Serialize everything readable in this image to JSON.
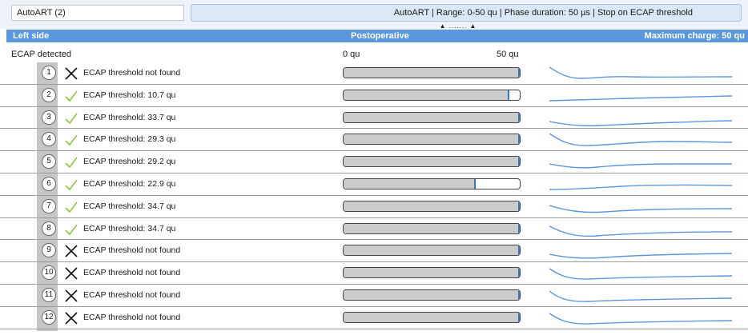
{
  "toolbar": {
    "tab_label": "AutoART (2)",
    "info": "AutoART | Range: 0-50 qu | Phase duration: 50 µs | Stop on ECAP threshold",
    "grip": "▲ ....... ▲"
  },
  "header": {
    "left": "Left side",
    "center": "Postoperative",
    "right": "Maximum charge: 50 qu"
  },
  "subheader": {
    "left": "ECAP detected",
    "min_label": "0 qu",
    "max_label": "50 qu"
  },
  "scale": {
    "min": 0,
    "max": 50
  },
  "colors": {
    "header_bg": "#5b97dd",
    "check": "#8dc63f",
    "cross": "#111111",
    "marker": "#3a74c8",
    "wave": "#5b97dd"
  },
  "rows": [
    {
      "index": "1",
      "status": "cross",
      "label": "ECAP threshold not found",
      "threshold": 50
    },
    {
      "index": "2",
      "status": "check",
      "label": "ECAP threshold: 10.7 qu",
      "threshold": 47
    },
    {
      "index": "3",
      "status": "check",
      "label": "ECAP threshold: 33.7 qu",
      "threshold": 50
    },
    {
      "index": "4",
      "status": "check",
      "label": "ECAP threshold: 29.3 qu",
      "threshold": 50
    },
    {
      "index": "5",
      "status": "check",
      "label": "ECAP threshold: 29.2 qu",
      "threshold": 50
    },
    {
      "index": "6",
      "status": "check",
      "label": "ECAP threshold: 22.9 qu",
      "threshold": 37.5
    },
    {
      "index": "7",
      "status": "check",
      "label": "ECAP threshold: 34.7 qu",
      "threshold": 50
    },
    {
      "index": "8",
      "status": "check",
      "label": "ECAP threshold: 34.7 qu",
      "threshold": 50
    },
    {
      "index": "9",
      "status": "cross",
      "label": "ECAP threshold not found",
      "threshold": 50
    },
    {
      "index": "10",
      "status": "cross",
      "label": "ECAP threshold not found",
      "threshold": 50
    },
    {
      "index": "11",
      "status": "cross",
      "label": "ECAP threshold not found",
      "threshold": 50
    },
    {
      "index": "12",
      "status": "cross",
      "label": "ECAP threshold not found",
      "threshold": 50
    }
  ]
}
